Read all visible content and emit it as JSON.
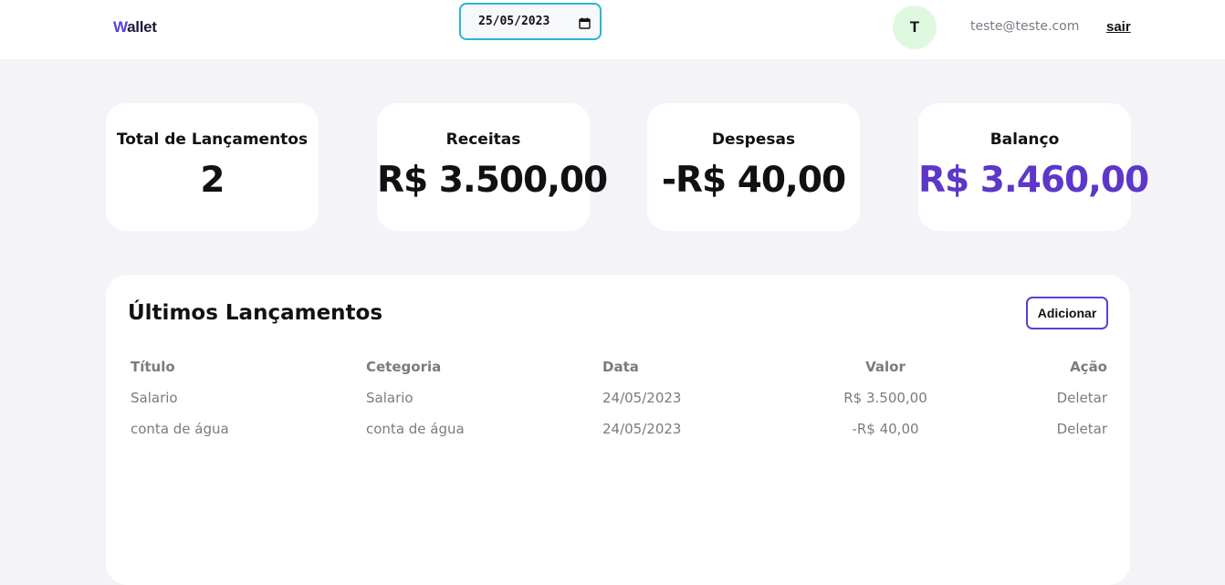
{
  "header": {
    "logo_initial": "W",
    "logo_rest": "allet",
    "date_value": "25/05/2023",
    "avatar_initial": "T",
    "user_email": "teste@teste.com",
    "logout_label": "sair"
  },
  "summary": {
    "total": {
      "label": "Total de Lançamentos",
      "value": "2"
    },
    "income": {
      "label": "Receitas",
      "value": "R$ 3.500,00"
    },
    "expenses": {
      "label": "Despesas",
      "value": "-R$ 40,00"
    },
    "balance": {
      "label": "Balanço",
      "value": "R$ 3.460,00",
      "color": "#5c37c9"
    }
  },
  "transactions": {
    "title": "Últimos Lançamentos",
    "add_label": "Adicionar",
    "columns": [
      "Título",
      "Cetegoria",
      "Data",
      "Valor",
      "Ação"
    ],
    "rows": [
      {
        "title": "Salario",
        "category": "Salario",
        "date": "24/05/2023",
        "value": "R$ 3.500,00",
        "action": "Deletar"
      },
      {
        "title": "conta de água",
        "category": "conta de água",
        "date": "24/05/2023",
        "value": "-R$ 40,00",
        "action": "Deletar"
      }
    ]
  },
  "colors": {
    "accent": "#5b3fd6",
    "date_border": "#2bb4d8",
    "avatar_bg": "#dff9e0",
    "page_bg": "#f3f3f8"
  },
  "icons": {
    "date_picker": "calendar-icon"
  }
}
